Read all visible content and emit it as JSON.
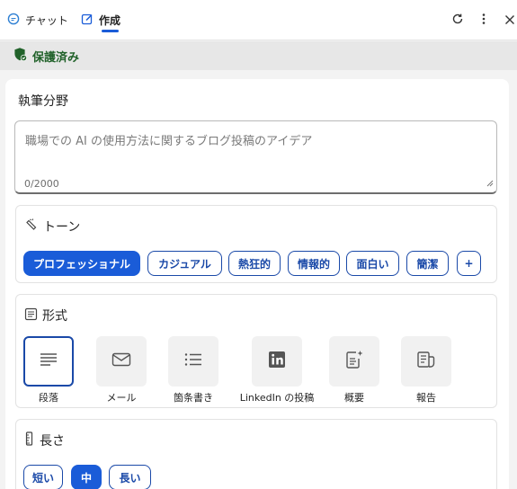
{
  "header": {
    "tabs": [
      {
        "label": "チャット",
        "icon": "chat-icon"
      },
      {
        "label": "作成",
        "icon": "compose-icon"
      }
    ],
    "actions": [
      "refresh-icon",
      "more-icon",
      "close-icon"
    ]
  },
  "protection": {
    "label": "保護済み",
    "color": "#21622a"
  },
  "topic": {
    "label": "執筆分野",
    "placeholder": "職場での AI の使用方法に関するブログ投稿のアイデア",
    "counter": "0/2000"
  },
  "tone": {
    "label": "トーン",
    "options": [
      "プロフェッショナル",
      "カジュアル",
      "熱狂的",
      "情報的",
      "面白い",
      "簡潔"
    ],
    "selected": "プロフェッショナル",
    "add_label": "+"
  },
  "format": {
    "label": "形式",
    "options": [
      {
        "label": "段落",
        "icon": "paragraph-icon"
      },
      {
        "label": "メール",
        "icon": "mail-icon"
      },
      {
        "label": "箇条書き",
        "icon": "bullet-list-icon"
      },
      {
        "label": "LinkedIn の投稿",
        "icon": "linkedin-icon"
      },
      {
        "label": "概要",
        "icon": "summary-icon"
      },
      {
        "label": "報告",
        "icon": "report-icon"
      }
    ],
    "selected": "段落"
  },
  "length": {
    "label": "長さ",
    "options": [
      "短い",
      "中",
      "長い"
    ],
    "selected": "中"
  },
  "colors": {
    "accent": "#1a5cd8",
    "chip_border": "#1a49a8"
  }
}
